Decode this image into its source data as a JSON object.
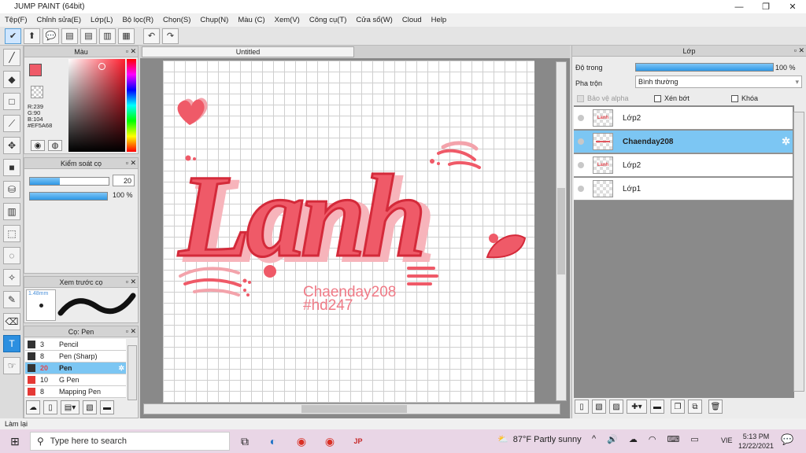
{
  "window": {
    "title": "JUMP PAINT (64bit)",
    "minimize": "—",
    "maximize": "❐",
    "close": "✕"
  },
  "menu": [
    "Tệp(F)",
    "Chỉnh sửa(E)",
    "Lớp(L)",
    "Bộ lọc(R)",
    "Chọn(S)",
    "Chụp(N)",
    "Màu (C)",
    "Xem(V)",
    "Công cụ(T)",
    "Cửa sổ(W)",
    "Cloud",
    "Help"
  ],
  "toolbar_icons": [
    "✔",
    "⬆",
    "💬",
    "▤",
    "▤",
    "▥",
    "▦",
    "↶",
    "↷"
  ],
  "color_panel": {
    "title": "Màu",
    "r": "R:239",
    "g": "G:90",
    "b": "B:104",
    "hex": "#EF5A68",
    "main_color": "#EF5A68",
    "accent": "#e01c2c"
  },
  "brush_control": {
    "title": "Kiểm soát cọ",
    "size": "20",
    "size_fill": 0.38,
    "opacity": "100 %",
    "opacity_fill": 1.0
  },
  "preview": {
    "title": "Xem trước cọ",
    "size_label": "1.48mm"
  },
  "brush_list": {
    "title": "Cọ: Pen",
    "items": [
      {
        "size": "3",
        "name": "Pencil",
        "color": "#333333"
      },
      {
        "size": "8",
        "name": "Pen (Sharp)",
        "color": "#333333"
      },
      {
        "size": "20",
        "name": "Pen",
        "color": "#333333"
      },
      {
        "size": "10",
        "name": "G Pen",
        "color": "#e53935"
      },
      {
        "size": "8",
        "name": "Mapping Pen",
        "color": "#e53935"
      }
    ]
  },
  "document": {
    "tab": "Untitled",
    "art_main": "Lanh",
    "art_line1": "Chaenday208",
    "art_line2": "#hd247"
  },
  "layer_panel": {
    "title": "Lớp",
    "opacity_label": "Độ trong",
    "opacity_value": "100 %",
    "blend_label": "Pha trộn",
    "blend_value": "Bình thường",
    "protect_alpha": "Bảo vệ alpha",
    "clip": "Xén bớt",
    "lock": "Khóa",
    "layers": [
      {
        "name": "Lớp2",
        "thumb": "Lanh"
      },
      {
        "name": "Chaenday208",
        "thumb": "▬▬▬"
      },
      {
        "name": "Lớp2",
        "thumb": "Lanh"
      },
      {
        "name": "Lớp1",
        "thumb": ""
      }
    ]
  },
  "status": {
    "text": "Làm lại"
  },
  "taskbar": {
    "search_placeholder": "Type here to search",
    "weather": "87°F  Partly sunny",
    "lang": "VIE",
    "time": "5:13 PM",
    "date": "12/22/2021"
  }
}
